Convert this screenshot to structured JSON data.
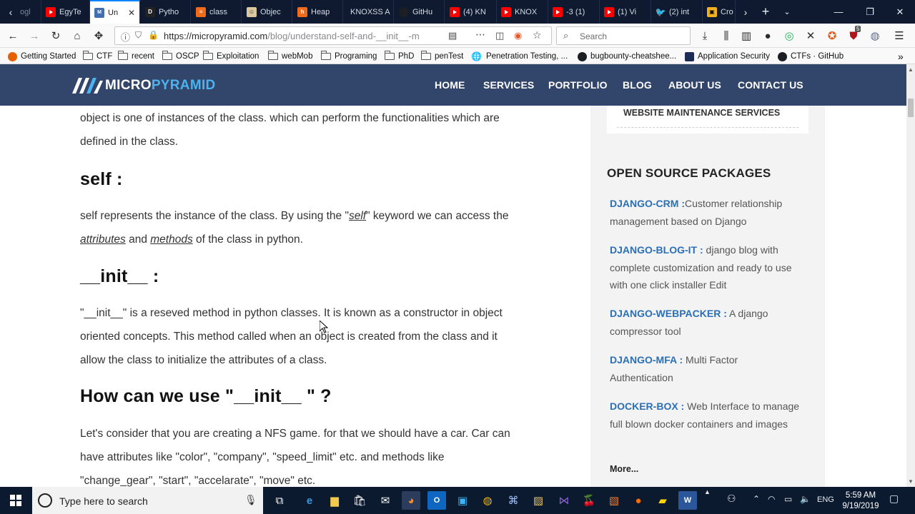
{
  "browser": {
    "tabs": [
      {
        "label": "ogl",
        "icon": "faded-tab-icon"
      },
      {
        "label": "EgyTe",
        "icon": "youtube-icon"
      },
      {
        "label": "Un",
        "icon": "micropyramid-icon",
        "active": true
      },
      {
        "label": "Pytho",
        "icon": "python-docs-icon"
      },
      {
        "label": "class",
        "icon": "stackoverflow-icon"
      },
      {
        "label": "Objec",
        "icon": "object-page-icon"
      },
      {
        "label": "Heap",
        "icon": "hackerrank-icon"
      },
      {
        "label": "KNOXSS A",
        "icon": "blank-icon"
      },
      {
        "label": "GitHu",
        "icon": "github-icon"
      },
      {
        "label": "(4) KN",
        "icon": "youtube-icon"
      },
      {
        "label": "KNOX",
        "icon": "youtube-icon"
      },
      {
        "label": "-3 (1)",
        "icon": "youtube-icon"
      },
      {
        "label": "(1) Vi",
        "icon": "youtube-icon"
      },
      {
        "label": "(2) int",
        "icon": "twitter-icon"
      },
      {
        "label": "Cro",
        "icon": "bookmark-site-icon"
      }
    ],
    "url_host": "https://micropyramid.com",
    "url_path": "/blog/understand-self-and-__init__-m",
    "search_placeholder": "Search",
    "extension_badge": "5"
  },
  "bookmarks": [
    {
      "label": "Getting Started",
      "icon": "firefox-icon"
    },
    {
      "label": "CTF",
      "icon": "folder-icon"
    },
    {
      "label": "recent",
      "icon": "folder-icon"
    },
    {
      "label": "OSCP",
      "icon": "folder-icon"
    },
    {
      "label": "Exploitation",
      "icon": "folder-icon"
    },
    {
      "label": "webMob",
      "icon": "folder-icon"
    },
    {
      "label": "Programing",
      "icon": "folder-icon"
    },
    {
      "label": "PhD",
      "icon": "folder-icon"
    },
    {
      "label": "penTest",
      "icon": "folder-icon"
    },
    {
      "label": "Penetration Testing, ...",
      "icon": "globe-icon"
    },
    {
      "label": "bugbounty-cheatshee...",
      "icon": "github-icon"
    },
    {
      "label": "Application Security",
      "icon": "info-icon"
    },
    {
      "label": "CTFs · GitHub",
      "icon": "github-icon"
    }
  ],
  "site": {
    "logo_part1": "MICRO",
    "logo_part2": "PYRAMID",
    "menu": [
      "HOME",
      "SERVICES",
      "PORTFOLIO",
      "BLOG",
      "ABOUT US",
      "CONTACT US"
    ]
  },
  "article": {
    "intro_1": "object is one of instances of the class. which can perform the functionalities which are",
    "intro_2": "defined in the class.",
    "h_self": "self :",
    "self_p1": "self represents the instance of the class. By using the \"",
    "self_kw": "self",
    "self_p2": "\" keyword we can access the",
    "self_attr": "attributes",
    "self_and": " and ",
    "self_methods": "methods",
    "self_p3": " of the class in python.",
    "h_init": "__init__ :",
    "init_l1": "\"__init__\" is a reseved method in python classes. It is known as a constructor in object",
    "init_l2": "oriented concepts. This method called when an object is created from the class and it",
    "init_l3": "allow the class to initialize the attributes of a class.",
    "h_use": "How can we use  \"__init__ \" ?",
    "use_l1": "Let's consider that you are creating a NFS game. for that we should have a car. Car can",
    "use_l2": "have attributes like \"color\", \"company\", \"speed_limit\" etc. and methods like",
    "use_l3": "\"change_gear\", \"start\", \"accelarate\", \"move\" etc."
  },
  "sidebar": {
    "service_item": "WEBSITE MAINTENANCE SERVICES",
    "packages_title": "OPEN SOURCE PACKAGES",
    "packages": [
      {
        "name": "DJANGO-CRM :",
        "desc": "Customer relationship management based on Django"
      },
      {
        "name": "DJANGO-BLOG-IT :",
        "desc": " django blog with complete customization and ready to use with one click installer Edit"
      },
      {
        "name": "DJANGO-WEBPACKER :",
        "desc": " A django compressor tool"
      },
      {
        "name": "DJANGO-MFA :",
        "desc": " Multi Factor Authentication"
      },
      {
        "name": "DOCKER-BOX :",
        "desc": " Web Interface to manage full blown docker containers and images"
      }
    ],
    "more": "More..."
  },
  "taskbar": {
    "search_placeholder": "Type here to search",
    "lang": "ENG",
    "time": "5:59 AM",
    "date": "9/19/2019"
  }
}
